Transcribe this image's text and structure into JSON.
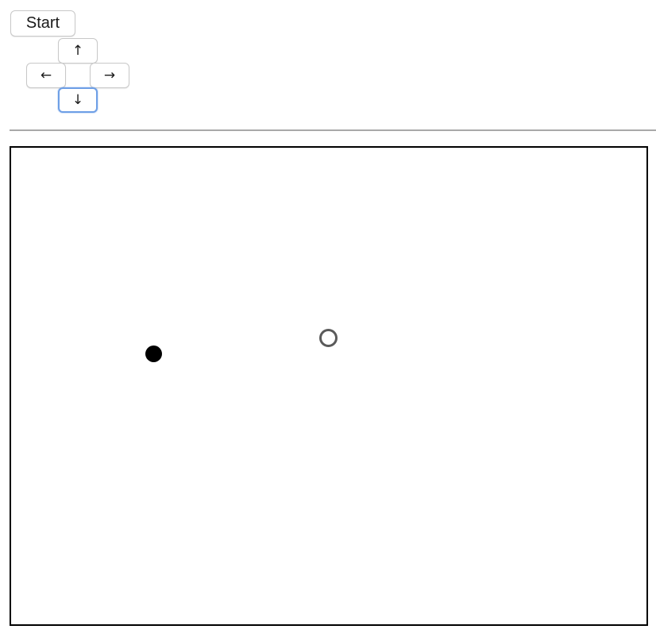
{
  "controls": {
    "start_label": "Start",
    "arrows": {
      "up": "↑",
      "left": "←",
      "right": "→",
      "down": "↓"
    },
    "focused_button": "down"
  },
  "game": {
    "player": {
      "icon": "filled-circle",
      "color": "#000000"
    },
    "target": {
      "icon": "hollow-circle",
      "color": "#5a5a5a"
    }
  }
}
